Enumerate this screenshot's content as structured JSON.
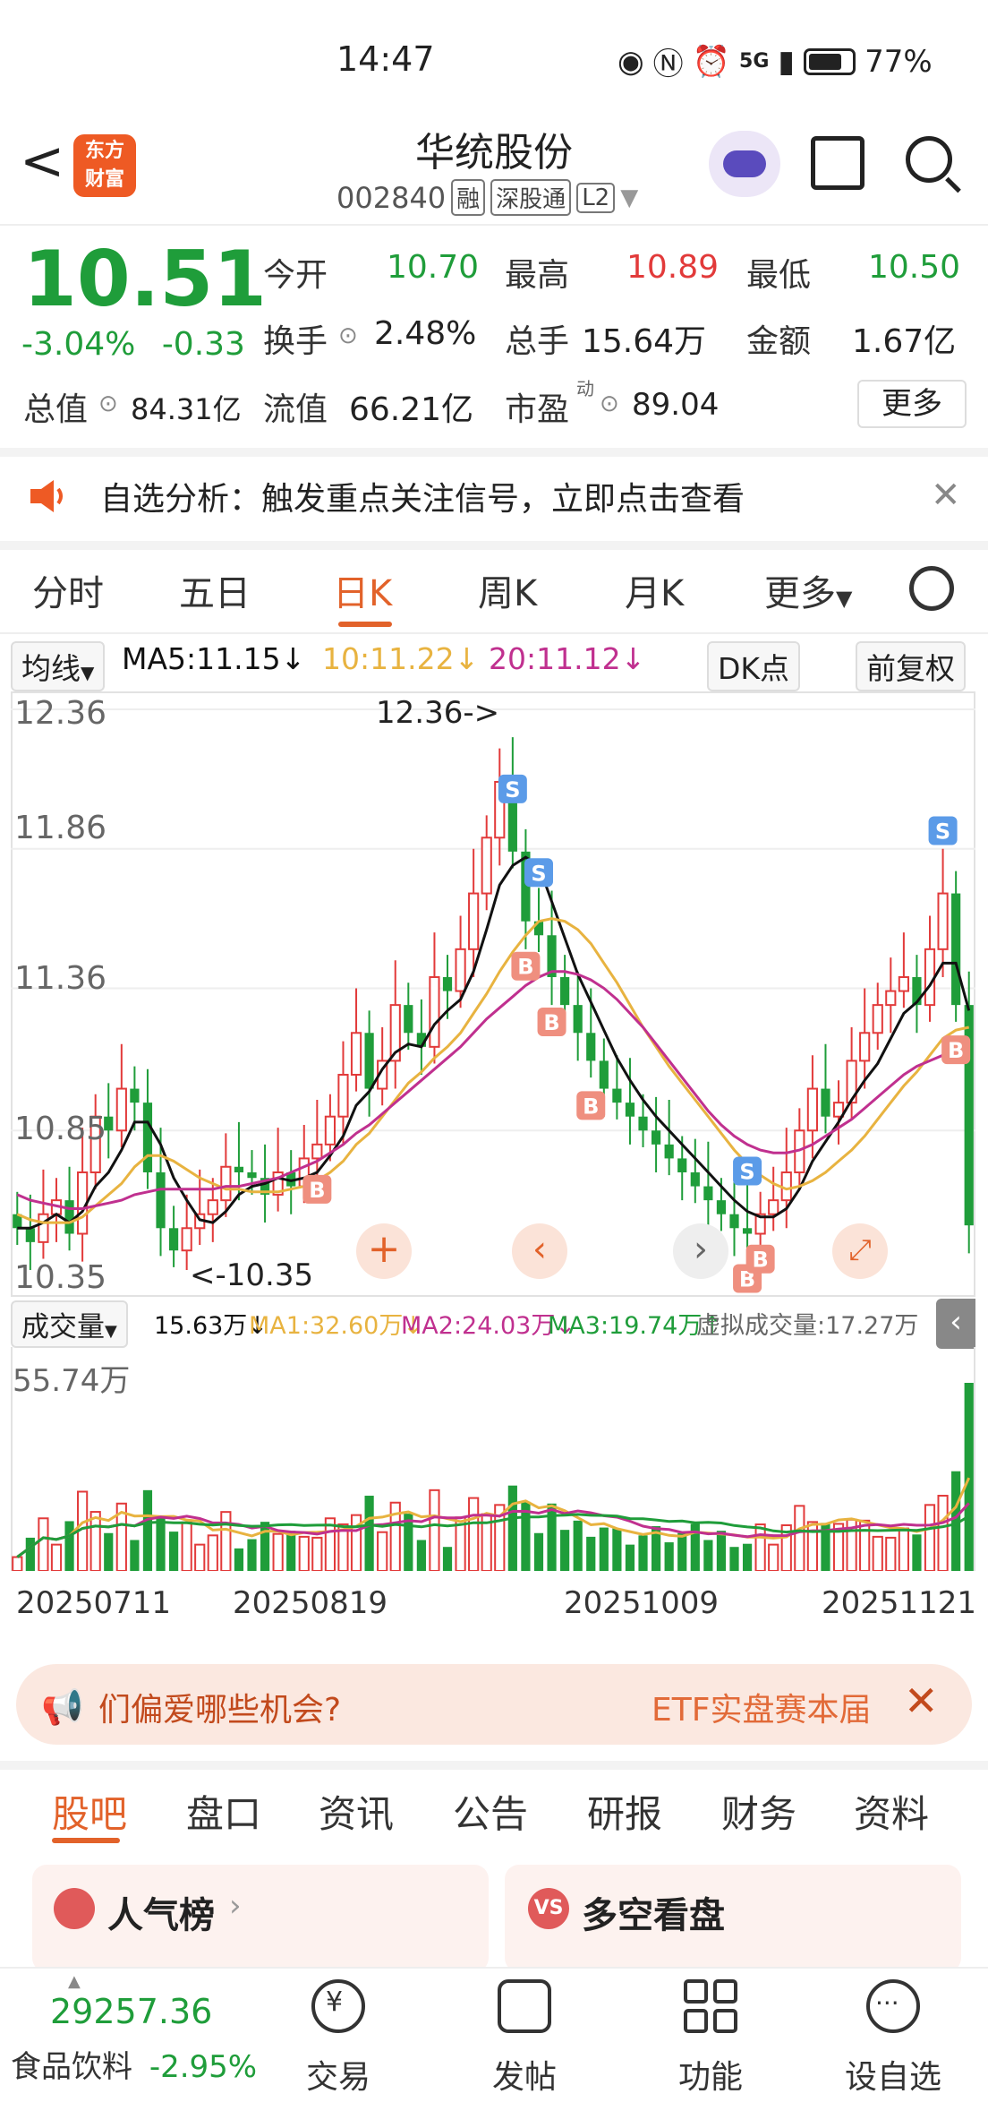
{
  "status": {
    "time": "14:47",
    "battery": "77%",
    "signal": "5G"
  },
  "header": {
    "name": "华统股份",
    "code": "002840",
    "tags": [
      "融",
      "深股通",
      "L2"
    ],
    "logo_line1": "东方",
    "logo_line2": "财富"
  },
  "quote": {
    "price": "10.51",
    "change_pct": "-3.04%",
    "change_abs": "-0.33",
    "open_label": "今开",
    "open": "10.70",
    "high_label": "最高",
    "high": "10.89",
    "low_label": "最低",
    "low": "10.50",
    "turnover_label": "换手",
    "turnover": "2.48%",
    "volume_label": "总手",
    "volume": "15.64万",
    "amount_label": "金额",
    "amount": "1.67亿",
    "mcap_label": "总值",
    "mcap": "84.31亿",
    "float_label": "流值",
    "float": "66.21亿",
    "pe_label": "市盈",
    "pe_sup": "动",
    "pe": "89.04",
    "more_label": "更多"
  },
  "alert": {
    "text": "自选分析：触发重点关注信号，立即点击查看"
  },
  "ktabs": [
    "分时",
    "五日",
    "日K",
    "周K",
    "月K",
    "更多"
  ],
  "ma": {
    "selector": "均线",
    "ma5": "MA5:11.15↓",
    "ma10": "10:11.22↓",
    "ma20": "20:11.12↓",
    "dk": "DK点",
    "adjust": "前复权"
  },
  "chart_labels": {
    "y_ticks": [
      "12.36",
      "11.86",
      "11.36",
      "10.85",
      "10.35"
    ],
    "high_marker": "12.36->",
    "low_marker": "<-10.35",
    "vol_max": "55.74万"
  },
  "vol_legend": {
    "selector": "成交量",
    "vol": "15.63万↓",
    "ma1": "MA1:32.60万↓",
    "ma2": "MA2:24.03万↓",
    "ma3": "MA3:19.74万↑",
    "virtual": "虚拟成交量:17.27万"
  },
  "dates": [
    "20250711",
    "20250819",
    "20251009",
    "20251121"
  ],
  "ad": {
    "text1": "们偏爱哪些机会?",
    "text2": "ETF实盘赛本届"
  },
  "btabs": [
    "股吧",
    "盘口",
    "资讯",
    "公告",
    "研报",
    "财务",
    "资料"
  ],
  "cards": {
    "left": "人气榜",
    "right": "多空看盘"
  },
  "nav": {
    "index_value": "29257.36",
    "sector": "食品饮料",
    "sector_change": "-2.95%",
    "items": [
      "交易",
      "发帖",
      "功能",
      "设自选"
    ]
  },
  "colors": {
    "up": "#e23a3a",
    "down": "#1f9d3a",
    "accent": "#e2622a",
    "ma5": "#111111",
    "ma10": "#e8b340",
    "ma20": "#c0308f"
  },
  "chart_data": {
    "type": "candlestick",
    "ylim": [
      10.35,
      12.36
    ],
    "high": 12.36,
    "low": 10.35,
    "close_series": [
      10.5,
      10.45,
      10.55,
      10.6,
      10.48,
      10.7,
      10.9,
      10.85,
      11.0,
      10.95,
      10.7,
      10.5,
      10.42,
      10.5,
      10.55,
      10.6,
      10.72,
      10.7,
      10.68,
      10.62,
      10.7,
      10.65,
      10.75,
      10.8,
      10.9,
      11.05,
      11.2,
      11.0,
      11.1,
      11.3,
      11.2,
      11.15,
      11.4,
      11.35,
      11.5,
      11.7,
      11.9,
      12.1,
      11.85,
      11.6,
      11.55,
      11.4,
      11.3,
      11.2,
      11.1,
      11.0,
      10.95,
      10.9,
      10.85,
      10.8,
      10.75,
      10.7,
      10.65,
      10.6,
      10.55,
      10.5,
      10.48,
      10.55,
      10.6,
      10.7,
      10.85,
      11.0,
      10.9,
      10.95,
      11.1,
      11.2,
      11.3,
      11.35,
      11.4,
      11.3,
      11.5,
      11.7,
      11.3,
      10.51
    ],
    "ma5": [
      10.5,
      10.5,
      10.52,
      10.55,
      10.52,
      10.56,
      10.65,
      10.7,
      10.78,
      10.88,
      10.88,
      10.8,
      10.68,
      10.6,
      10.53,
      10.52,
      10.56,
      10.62,
      10.65,
      10.66,
      10.68,
      10.67,
      10.68,
      10.7,
      10.76,
      10.83,
      10.94,
      10.99,
      11.07,
      11.13,
      11.16,
      11.15,
      11.23,
      11.28,
      11.32,
      11.42,
      11.57,
      11.73,
      11.8,
      11.83,
      11.8,
      11.67,
      11.54,
      11.41,
      11.31,
      11.21,
      11.11,
      11.03,
      10.96,
      10.9,
      10.85,
      10.8,
      10.75,
      10.7,
      10.65,
      10.6,
      10.56,
      10.54,
      10.54,
      10.57,
      10.64,
      10.74,
      10.81,
      10.88,
      10.96,
      11.03,
      11.09,
      11.18,
      11.27,
      11.31,
      11.37,
      11.45,
      11.45,
      11.28
    ],
    "ma10": [
      10.55,
      10.53,
      10.52,
      10.52,
      10.52,
      10.54,
      10.58,
      10.62,
      10.66,
      10.72,
      10.76,
      10.76,
      10.74,
      10.71,
      10.68,
      10.66,
      10.64,
      10.64,
      10.63,
      10.63,
      10.63,
      10.64,
      10.65,
      10.67,
      10.7,
      10.74,
      10.8,
      10.84,
      10.9,
      10.96,
      11.02,
      11.06,
      11.11,
      11.15,
      11.2,
      11.27,
      11.34,
      11.42,
      11.49,
      11.55,
      11.6,
      11.61,
      11.6,
      11.57,
      11.52,
      11.45,
      11.38,
      11.3,
      11.22,
      11.15,
      11.08,
      11.02,
      10.96,
      10.9,
      10.84,
      10.78,
      10.73,
      10.69,
      10.66,
      10.64,
      10.65,
      10.67,
      10.7,
      10.74,
      10.78,
      10.83,
      10.89,
      10.95,
      11.01,
      11.06,
      11.12,
      11.18,
      11.21,
      11.22
    ],
    "ma20": [
      10.62,
      10.6,
      10.59,
      10.58,
      10.57,
      10.57,
      10.58,
      10.59,
      10.6,
      10.62,
      10.63,
      10.64,
      10.64,
      10.64,
      10.64,
      10.64,
      10.65,
      10.65,
      10.66,
      10.67,
      10.68,
      10.7,
      10.72,
      10.74,
      10.77,
      10.8,
      10.84,
      10.87,
      10.91,
      10.95,
      10.99,
      11.03,
      11.07,
      11.11,
      11.15,
      11.2,
      11.25,
      11.29,
      11.33,
      11.37,
      11.4,
      11.42,
      11.42,
      11.41,
      11.39,
      11.36,
      11.32,
      11.27,
      11.22,
      11.16,
      11.1,
      11.04,
      10.98,
      10.92,
      10.87,
      10.83,
      10.8,
      10.78,
      10.77,
      10.77,
      10.78,
      10.8,
      10.83,
      10.86,
      10.89,
      10.93,
      10.97,
      11.01,
      11.05,
      11.08,
      11.1,
      11.12,
      11.13,
      11.12
    ],
    "volume_max_label": "55.74万"
  }
}
